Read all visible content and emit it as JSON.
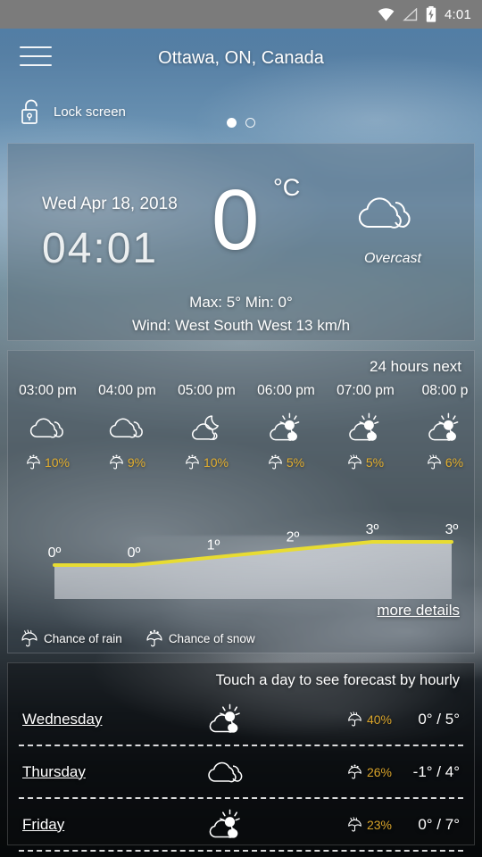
{
  "status_bar": {
    "time": "4:01",
    "icons": [
      "wifi-icon",
      "signal-icon",
      "battery-charging-icon"
    ]
  },
  "header": {
    "title": "Ottawa, ON, Canada",
    "menu_icon": "hamburger-menu-icon",
    "lock_label": "Lock screen",
    "lock_icon": "unlocked-padlock-icon",
    "page_dots": 2,
    "active_page": 1
  },
  "current": {
    "date": "Wed Apr 18, 2018",
    "time": "04:01",
    "temperature": "0",
    "unit": "°C",
    "condition": "Overcast",
    "condition_icon": "overcast-cloud-icon",
    "max_min": "Max: 5°  Min: 0°",
    "wind": "Wind: West South West 13 km/h"
  },
  "hourly": {
    "label": "24 hours next",
    "more_details": "more details",
    "legend": [
      {
        "label": "Chance of rain",
        "icon": "umbrella-rain-icon"
      },
      {
        "label": "Chance of snow",
        "icon": "umbrella-snow-icon"
      }
    ],
    "columns": [
      {
        "time": "03:00 pm",
        "icon": "overcast-cloud-icon",
        "precip": "10%",
        "precip_icon": "umbrella-snow-icon",
        "temp_label": "0º",
        "temp": 0
      },
      {
        "time": "04:00 pm",
        "icon": "overcast-cloud-icon",
        "precip": "9%",
        "precip_icon": "umbrella-snow-icon",
        "temp_label": "0º",
        "temp": 0
      },
      {
        "time": "05:00 pm",
        "icon": "moon-cloud-icon",
        "precip": "10%",
        "precip_icon": "umbrella-snow-icon",
        "temp_label": "1º",
        "temp": 1
      },
      {
        "time": "06:00 pm",
        "icon": "sun-cloud-icon",
        "precip": "5%",
        "precip_icon": "umbrella-snow-icon",
        "temp_label": "2º",
        "temp": 2
      },
      {
        "time": "07:00 pm",
        "icon": "sun-cloud-icon",
        "precip": "5%",
        "precip_icon": "umbrella-rain-icon",
        "temp_label": "3º",
        "temp": 3
      },
      {
        "time": "08:00 p",
        "icon": "sun-cloud-icon",
        "precip": "6%",
        "precip_icon": "umbrella-rain-icon",
        "temp_label": "3º",
        "temp": 3
      }
    ]
  },
  "daily": {
    "hint": "Touch a day to see forecast by hourly",
    "rows": [
      {
        "day": "Wednesday",
        "icon": "sun-cloud-icon",
        "precip": "40%",
        "precip_icon": "umbrella-rain-icon",
        "temps": "0° / 5°"
      },
      {
        "day": "Thursday",
        "icon": "overcast-cloud-icon",
        "precip": "26%",
        "precip_icon": "umbrella-snow-icon",
        "temps": "-1° / 4°"
      },
      {
        "day": "Friday",
        "icon": "sun-cloud-icon",
        "precip": "23%",
        "precip_icon": "umbrella-rain-icon",
        "temps": "0° / 7°"
      }
    ]
  },
  "chart_data": {
    "type": "line",
    "title": "24 hours next",
    "categories": [
      "03:00 pm",
      "04:00 pm",
      "05:00 pm",
      "06:00 pm",
      "07:00 pm",
      "08:00 p"
    ],
    "values": [
      0,
      0,
      1,
      2,
      3,
      3
    ],
    "labels": [
      "0º",
      "0º",
      "1º",
      "2º",
      "3º",
      "3º"
    ],
    "xlabel": "",
    "ylabel": "",
    "ylim": [
      0,
      3
    ],
    "line_color": "#e8dc32",
    "fill_color": "#c8ccd2",
    "grid": false,
    "legend": false
  },
  "colors": {
    "accent_yellow": "#e2ae2e",
    "chart_line": "#e8dc32",
    "status_bar": "#7b7b7b",
    "text": "#ffffff"
  }
}
